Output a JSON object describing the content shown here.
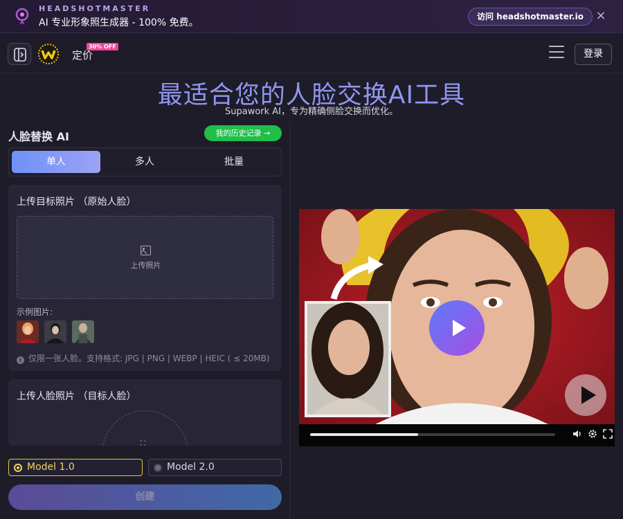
{
  "promo": {
    "brand": "HEADSHOTMASTER",
    "text": "AI 专业形象照生成器 - 100% 免费。",
    "visit_label": "访问 headshotmaster.io",
    "close_icon": "×"
  },
  "nav": {
    "pricing_label": "定价",
    "badge": "30% OFF",
    "login_label": "登录"
  },
  "hero": {
    "title": "最适合您的人脸交换AI工具",
    "subtitle": "Supawork AI，专为精确侧脸交换而优化。"
  },
  "panel": {
    "title": "人脸替换 AI",
    "history_label": "我的历史记录 →",
    "tabs": [
      {
        "label": "单人",
        "active": true
      },
      {
        "label": "多人",
        "active": false
      },
      {
        "label": "批量",
        "active": false
      }
    ]
  },
  "target_upload": {
    "title": "上传目标照片 （原始人脸）",
    "dropzone_label": "上传照片",
    "examples_label": "示例图片:",
    "note": "仅限一张人脸。支持格式: JPG | PNG | WEBP | HEIC ( ≤ 20MB)"
  },
  "face_upload": {
    "title": "上传人脸照片 （目标人脸）",
    "circle_icon": "⛶"
  },
  "models": [
    {
      "label": "Model 1.0",
      "selected": true
    },
    {
      "label": "Model 2.0",
      "selected": false
    }
  ],
  "create_label": "创建",
  "video": {
    "progress": 0.44,
    "volume_icon": "speaker-icon",
    "settings_icon": "gear-icon",
    "fullscreen_icon": "fullscreen-icon"
  },
  "colors": {
    "accent_title": "#8f96f0",
    "history_green": "#1fbf4a",
    "model_selected": "#f2d55e",
    "badge_pink": "#ec4899"
  }
}
